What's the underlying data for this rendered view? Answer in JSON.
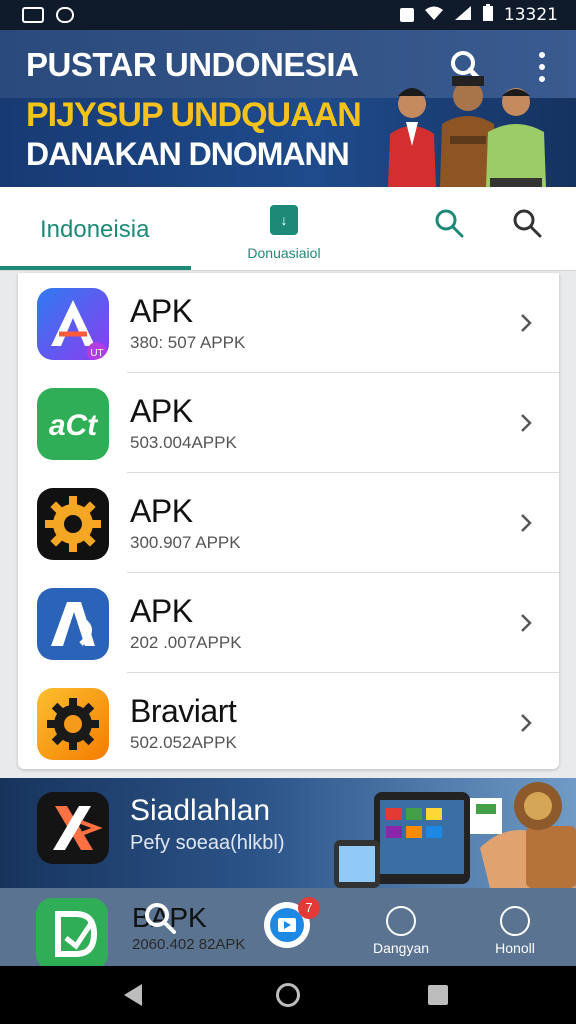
{
  "status_bar": {
    "time": "13321"
  },
  "header": {
    "title": "PUSTAR UNDONESIA",
    "banner_line1": "PIJYSUP UNDQUAAN",
    "banner_line2": "DANAKAN DNOMANN"
  },
  "tabs": {
    "indonesia_label": "Indoneisia",
    "download_label": "Donuasiaiol"
  },
  "apps": [
    {
      "name": "APK",
      "sub": "380: 507 APPK",
      "icon": "app-a-icon",
      "badge": "UT"
    },
    {
      "name": "APK",
      "sub": "503.004APPK",
      "icon": "app-green-icon",
      "icon_text": "aCt"
    },
    {
      "name": "APK",
      "sub": "300.907 APPK",
      "icon": "gear-icon"
    },
    {
      "name": "APK",
      "sub": "202 .007APPK",
      "icon": "app-blue-a-icon"
    },
    {
      "name": "Braviart",
      "sub": "502.052APPK",
      "icon": "orange-gear-icon"
    }
  ],
  "promo": {
    "title": "Siadlahlan",
    "subtitle": "Pefy soeaa(hlkbl)"
  },
  "bottom_nav": {
    "app_name": "BAPK",
    "app_sub": "2060.402 82APK",
    "badge_count": "7",
    "item3_label": "Dangyan",
    "item4_label": "Honoll"
  },
  "colors": {
    "accent": "#1d8a78",
    "header": "#1f4b8c",
    "banner_yellow": "#f3c21b"
  }
}
